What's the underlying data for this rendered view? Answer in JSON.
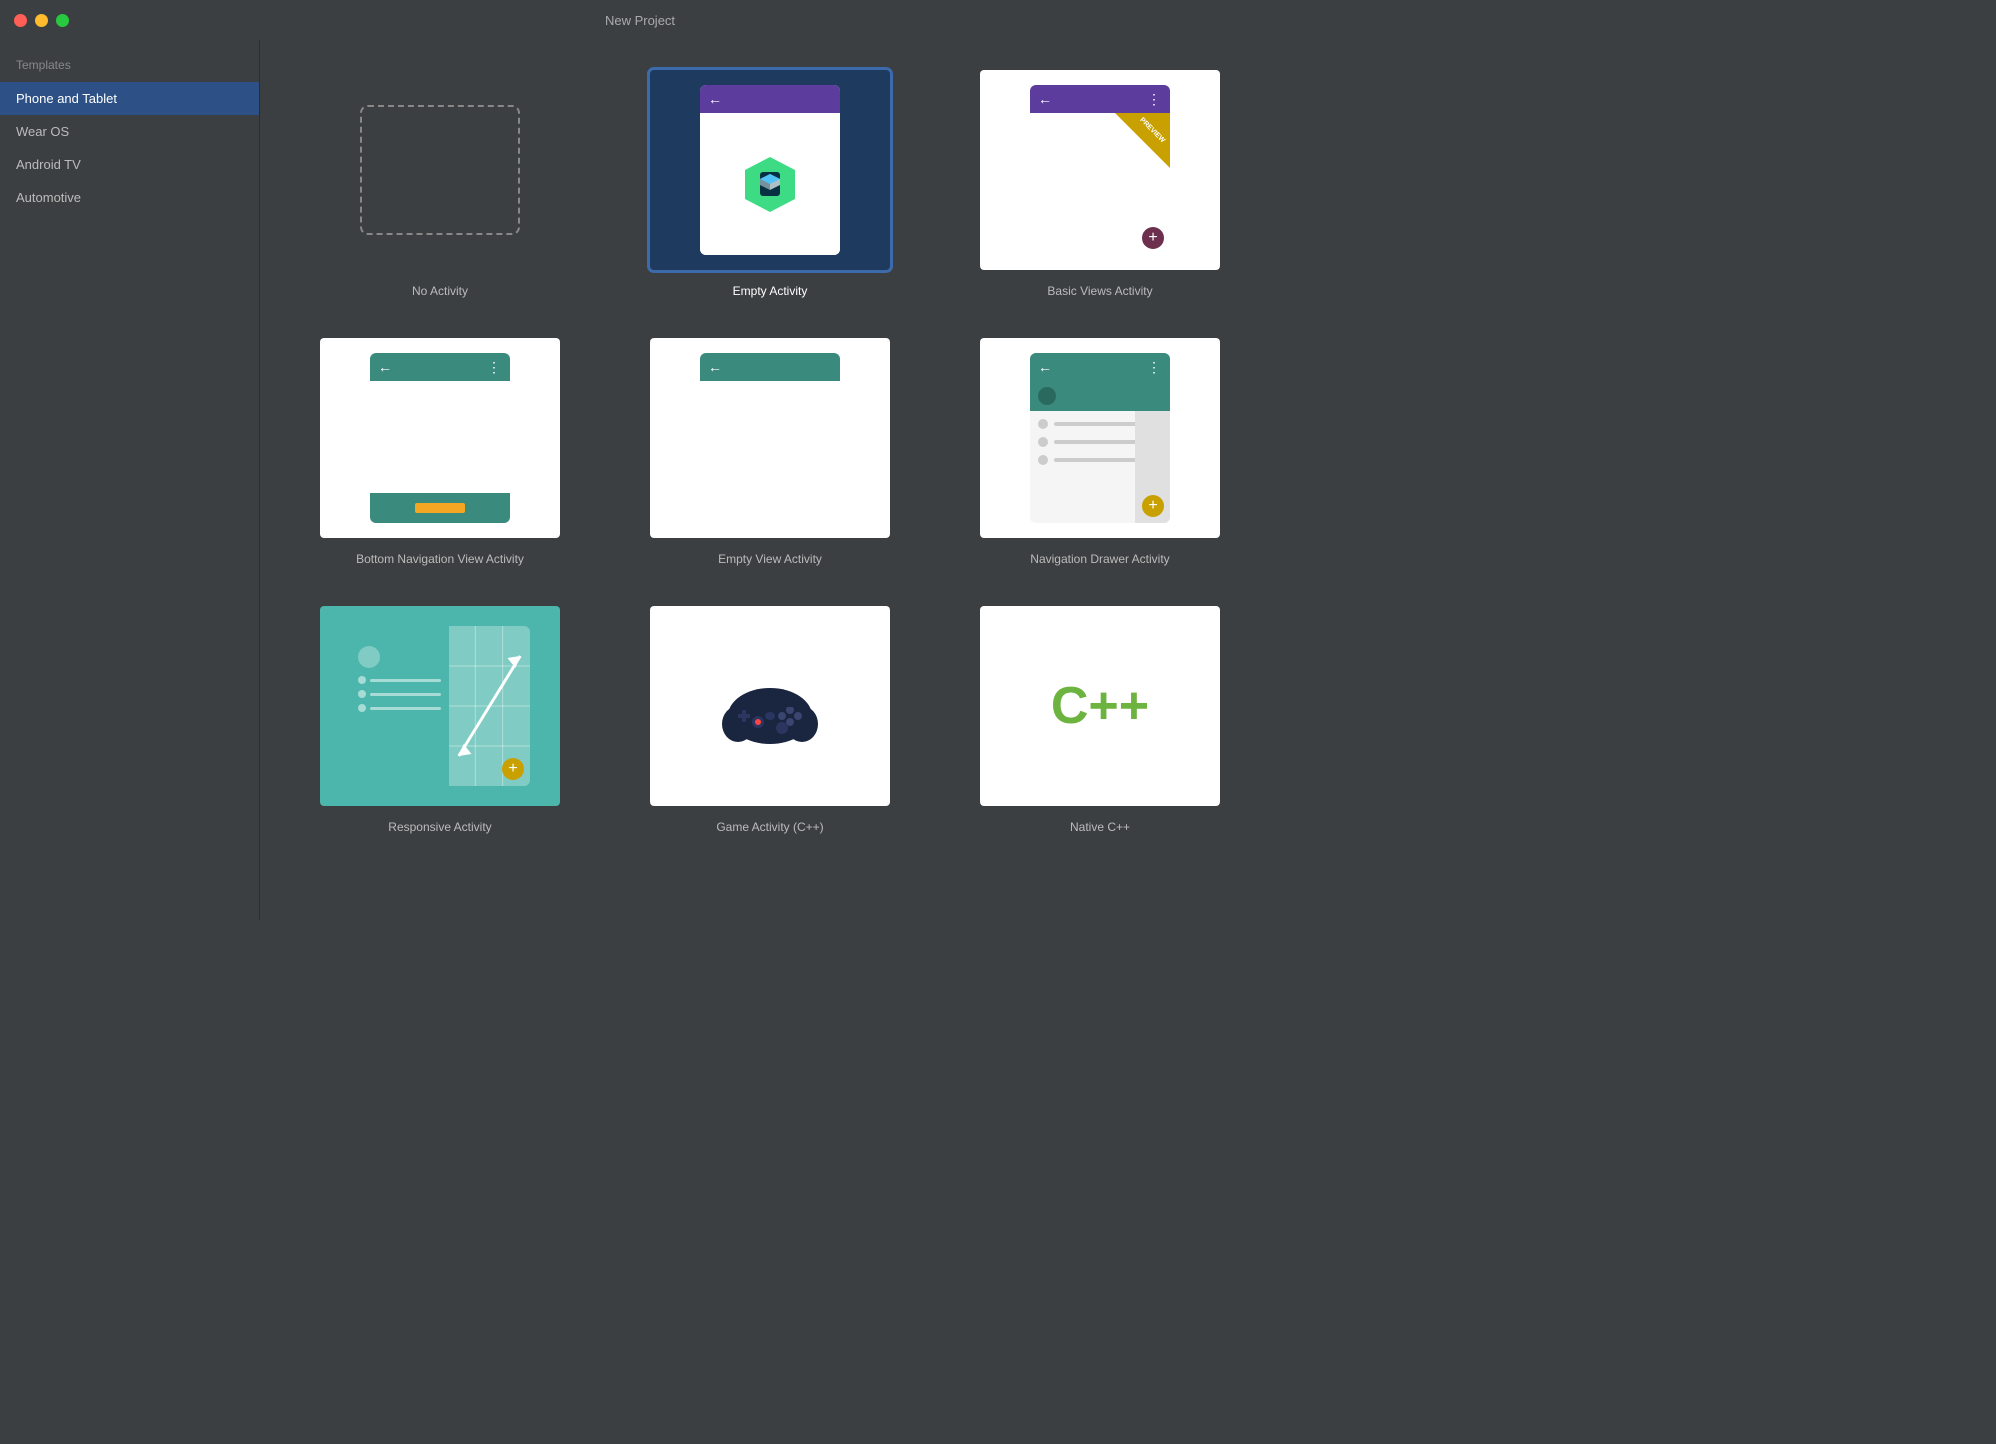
{
  "window": {
    "title": "New Project"
  },
  "sidebar": {
    "section_label": "Templates",
    "items": [
      {
        "id": "phone-tablet",
        "label": "Phone and Tablet",
        "active": true
      },
      {
        "id": "wear-os",
        "label": "Wear OS",
        "active": false
      },
      {
        "id": "android-tv",
        "label": "Android TV",
        "active": false
      },
      {
        "id": "automotive",
        "label": "Automotive",
        "active": false
      }
    ]
  },
  "templates": [
    {
      "id": "no-activity",
      "label": "No Activity",
      "selected": false
    },
    {
      "id": "empty-activity",
      "label": "Empty Activity",
      "selected": true
    },
    {
      "id": "basic-views-activity",
      "label": "Basic Views Activity",
      "selected": false
    },
    {
      "id": "bottom-nav-activity",
      "label": "Bottom Navigation View Activity",
      "selected": false
    },
    {
      "id": "empty-view-activity",
      "label": "Empty View Activity",
      "selected": false
    },
    {
      "id": "navigation-drawer-activity",
      "label": "Navigation Drawer Activity",
      "selected": false
    },
    {
      "id": "responsive-activity",
      "label": "Responsive Activity",
      "selected": false
    },
    {
      "id": "game-activity",
      "label": "Game Activity (C++)",
      "selected": false
    },
    {
      "id": "native-cpp",
      "label": "Native C++",
      "selected": false
    }
  ]
}
